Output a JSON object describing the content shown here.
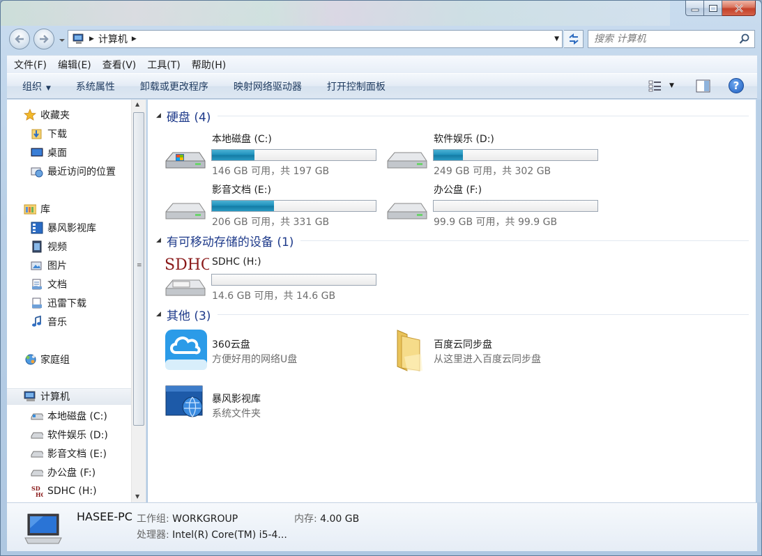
{
  "window": {
    "caption_buttons": [
      "minimize",
      "maximize",
      "close"
    ]
  },
  "address": {
    "crumb": "计算机",
    "search_placeholder": "搜索 计算机"
  },
  "menubar": [
    "文件(F)",
    "编辑(E)",
    "查看(V)",
    "工具(T)",
    "帮助(H)"
  ],
  "commandbar": {
    "organize": "组织",
    "items": [
      "系统属性",
      "卸载或更改程序",
      "映射网络驱动器",
      "打开控制面板"
    ]
  },
  "navpane": {
    "favorites": {
      "label": "收藏夹",
      "items": [
        "下载",
        "桌面",
        "最近访问的位置"
      ]
    },
    "libraries": {
      "label": "库",
      "items": [
        "暴风影视库",
        "视频",
        "图片",
        "文档",
        "迅雷下载",
        "音乐"
      ]
    },
    "homegroup": "家庭组",
    "computer": {
      "label": "计算机",
      "items": [
        "本地磁盘 (C:)",
        "软件娱乐 (D:)",
        "影音文档 (E:)",
        "办公盘 (F:)",
        "SDHC (H:)"
      ]
    }
  },
  "groups": {
    "hdd": {
      "title": "硬盘 (4)"
    },
    "removable": {
      "title": "有可移动存储的设备 (1)"
    },
    "other": {
      "title": "其他 (3)"
    }
  },
  "drives": [
    {
      "name": "本地磁盘 (C:)",
      "info": "146 GB 可用，共 197 GB",
      "used_fraction": 0.26
    },
    {
      "name": "软件娱乐 (D:)",
      "info": "249 GB 可用，共 302 GB",
      "used_fraction": 0.18
    },
    {
      "name": "影音文档 (E:)",
      "info": "206 GB 可用，共 331 GB",
      "used_fraction": 0.38
    },
    {
      "name": "办公盘 (F:)",
      "info": "99.9 GB 可用，共 99.9 GB",
      "used_fraction": 0.0
    }
  ],
  "removable_drives": [
    {
      "name": "SDHC (H:)",
      "info": "14.6 GB 可用，共 14.6 GB",
      "used_fraction": 0.0,
      "icon_text": "SDHC"
    }
  ],
  "other_items": [
    {
      "name": "360云盘",
      "desc": "方便好用的网络U盘"
    },
    {
      "name": "百度云同步盘",
      "desc": "从这里进入百度云同步盘"
    },
    {
      "name": "暴风影视库",
      "desc": "系统文件夹"
    }
  ],
  "details": {
    "hostname": "HASEE-PC",
    "workgroup_label": "工作组:",
    "workgroup": "WORKGROUP",
    "memory_label": "内存:",
    "memory": "4.00 GB",
    "cpu_label": "处理器:",
    "cpu": "Intel(R) Core(TM) i5-4..."
  },
  "colors": {
    "progress_fill": "#1d8fbb",
    "group_title": "#1e3a8a",
    "close_button": "#c4412a"
  }
}
